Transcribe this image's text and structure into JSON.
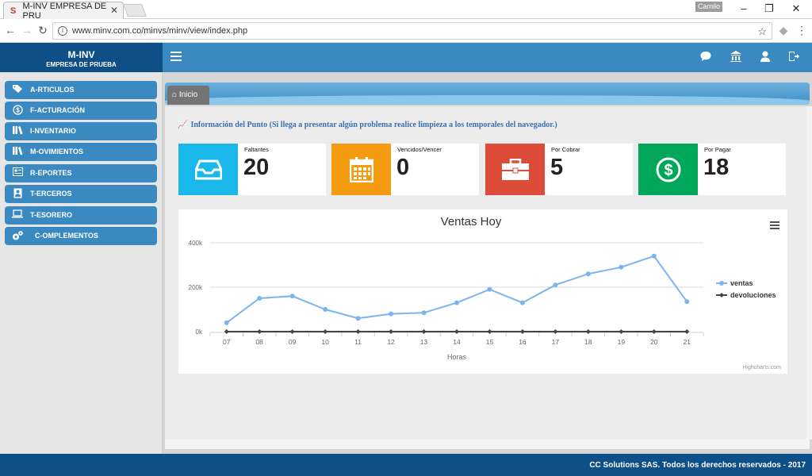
{
  "browser": {
    "tab_title": "M-INV EMPRESA DE PRU",
    "tab_close": "✕",
    "user_badge": "Camilo",
    "url": "www.minv.com.co/minvs/minv/view/index.php"
  },
  "app": {
    "brand": "M-INV",
    "company": "EMPRESA DE PRUEBA"
  },
  "sidebar": {
    "items": [
      {
        "label": "A-RTICULOS",
        "icon": "tag-icon"
      },
      {
        "label": "F-ACTURACIÓN",
        "icon": "dollar-icon"
      },
      {
        "label": "I-NVENTARIO",
        "icon": "books-icon"
      },
      {
        "label": "M-OVIMIENTOS",
        "icon": "books-icon"
      },
      {
        "label": "R-EPORTES",
        "icon": "report-icon"
      },
      {
        "label": "T-ERCEROS",
        "icon": "contact-icon"
      },
      {
        "label": "T-ESORERO",
        "icon": "laptop-icon"
      },
      {
        "label": "C-OMPLEMENTOS",
        "icon": "gears-icon"
      }
    ]
  },
  "breadcrumb": {
    "home_label": "Inicio"
  },
  "info_text": "Información del Punto (Si llega a presentar algún problema realice limpieza a los temporales del navegador.)",
  "cards": [
    {
      "label": "Faltantes",
      "value": "20",
      "color": "#1ab7ea",
      "icon": "inbox-icon"
    },
    {
      "label": "Vencidos/Vencer",
      "value": "0",
      "color": "#f39c12",
      "icon": "calendar-icon"
    },
    {
      "label": "Por Cobrar",
      "value": "5",
      "color": "#dd4b39",
      "icon": "briefcase-icon"
    },
    {
      "label": "Por Pagar",
      "value": "18",
      "color": "#00a65a",
      "icon": "dollar-circle-icon"
    }
  ],
  "chart_data": {
    "type": "line",
    "title": "Ventas Hoy",
    "xlabel": "Horas",
    "ylabel": "",
    "categories": [
      "07",
      "08",
      "09",
      "10",
      "11",
      "12",
      "13",
      "14",
      "15",
      "16",
      "17",
      "18",
      "19",
      "20",
      "21"
    ],
    "y_ticks": [
      "0k",
      "200k",
      "400k"
    ],
    "ylim": [
      0,
      400000
    ],
    "series": [
      {
        "name": "ventas",
        "color": "#7cb5ec",
        "values": [
          40000,
          150000,
          160000,
          100000,
          60000,
          80000,
          85000,
          130000,
          190000,
          130000,
          210000,
          260000,
          290000,
          340000,
          135000
        ]
      },
      {
        "name": "devoluciones",
        "color": "#434348",
        "values": [
          0,
          0,
          0,
          0,
          0,
          0,
          0,
          0,
          0,
          0,
          0,
          0,
          0,
          0,
          0
        ]
      }
    ],
    "legend_position": "right",
    "credits": "Highcharts.com"
  },
  "footer": {
    "text": "CC Solutions SAS. Todos los derechos reservados - 2017"
  }
}
